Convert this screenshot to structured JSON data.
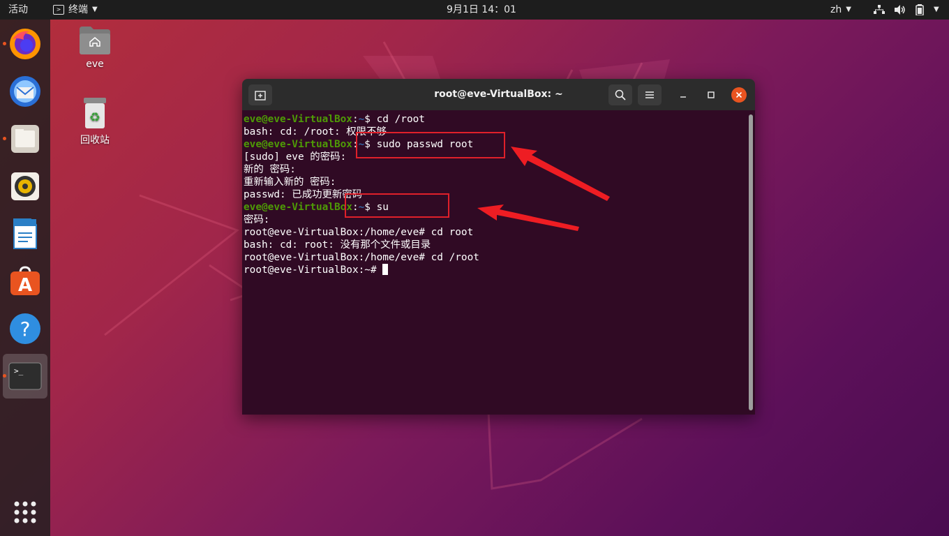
{
  "topbar": {
    "activities": "活动",
    "app_menu": "终端",
    "clock": "9月1日  14：01",
    "language": "zh"
  },
  "dock": {
    "apps": [
      "firefox-icon",
      "thunderbird-icon",
      "files-icon",
      "rhythmbox-icon",
      "libreoffice-writer-icon",
      "ubuntu-software-icon",
      "help-icon",
      "terminal-icon"
    ]
  },
  "desktop": {
    "home_label": "eve",
    "trash_label": "回收站"
  },
  "window": {
    "title": "root@eve-VirtualBox: ~"
  },
  "terminal": {
    "lines": [
      {
        "user": "eve@eve-VirtualBox",
        "path": "~",
        "sym": "$ ",
        "cmd": "cd /root"
      },
      {
        "text": "bash: cd: /root: 权限不够"
      },
      {
        "user": "eve@eve-VirtualBox",
        "path": "~",
        "sym": "$ ",
        "cmd": "sudo passwd root"
      },
      {
        "text": "[sudo] eve 的密码:"
      },
      {
        "text": "新的 密码:"
      },
      {
        "text": "重新输入新的 密码:"
      },
      {
        "text": "passwd: 已成功更新密码"
      },
      {
        "user": "eve@eve-VirtualBox",
        "path": "~",
        "sym": "$ ",
        "cmd": "su"
      },
      {
        "text": "密码:"
      },
      {
        "text": "root@eve-VirtualBox:/home/eve# cd root"
      },
      {
        "text": "bash: cd: root: 没有那个文件或目录"
      },
      {
        "text": "root@eve-VirtualBox:/home/eve# cd /root"
      },
      {
        "text": "root@eve-VirtualBox:~# ",
        "cursor": true
      }
    ]
  },
  "colors": {
    "terminal_bg": "#300a24",
    "prompt_user": "#4e9a06",
    "prompt_path": "#3465a4",
    "accent": "#e95420",
    "annotation": "#e0202a"
  }
}
